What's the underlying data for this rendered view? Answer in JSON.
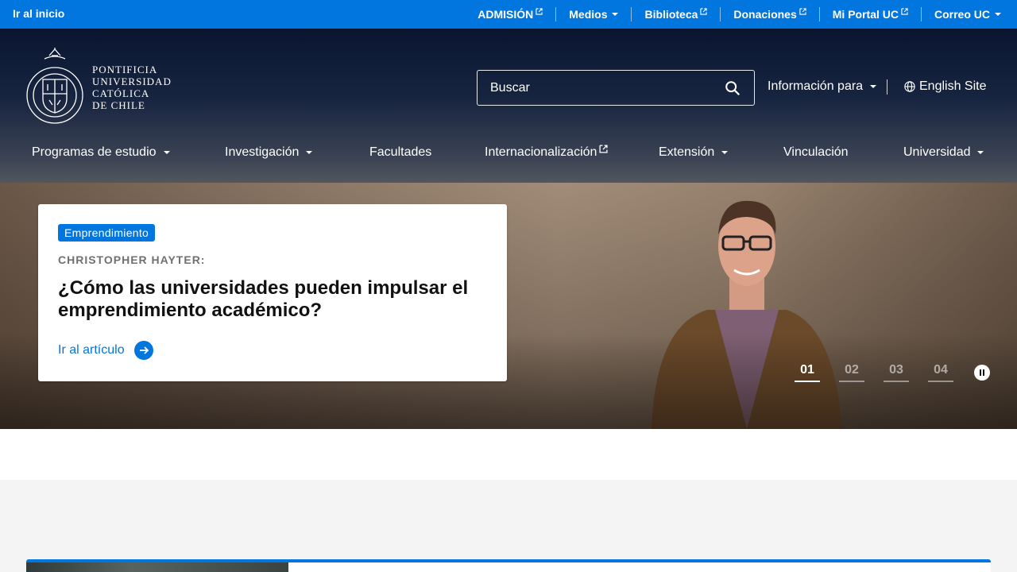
{
  "topbar": {
    "skip_label": "Ir al inicio",
    "items": [
      {
        "label": "ADMISIÓN",
        "icon": "external-link-icon"
      },
      {
        "label": "Medios",
        "icon": "caret-down-icon"
      },
      {
        "label": "Biblioteca",
        "icon": "external-link-icon"
      },
      {
        "label": "Donaciones",
        "icon": "external-link-icon"
      },
      {
        "label": "Mi Portal UC",
        "icon": "external-link-icon"
      },
      {
        "label": "Correo UC",
        "icon": "caret-down-icon"
      }
    ],
    "bg_color": "#0176de"
  },
  "header": {
    "logo_lines": [
      "PONTIFICIA",
      "UNIVERSIDAD",
      "CATÓLICA",
      "DE CHILE"
    ],
    "search": {
      "placeholder": "Buscar"
    },
    "info_para": "Información para",
    "english_site": "English Site"
  },
  "mainnav": {
    "items": [
      {
        "label": "Programas de estudio"
      },
      {
        "label": "Investigación"
      },
      {
        "label": "Facultades"
      },
      {
        "label": "Internacionalización"
      },
      {
        "label": "Extensión"
      },
      {
        "label": "Vinculación"
      },
      {
        "label": "Universidad"
      }
    ]
  },
  "hero": {
    "tag": "Emprendimiento",
    "kicker": "Christopher Hayter:",
    "headline": "¿Cómo las universidades pueden impulsar el emprendimiento académico?",
    "cta": "Ir al artículo",
    "slides": [
      "01",
      "02",
      "03",
      "04"
    ],
    "active_slide": "01"
  }
}
